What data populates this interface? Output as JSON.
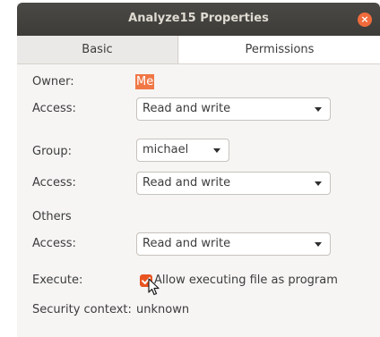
{
  "window": {
    "title": "Analyze15 Properties",
    "close_symbol": "×"
  },
  "tabs": [
    {
      "label": "Basic",
      "active": false
    },
    {
      "label": "Permissions",
      "active": true
    }
  ],
  "permissions": {
    "owner_label": "Owner:",
    "owner_value": "Me",
    "owner_access_label": "Access:",
    "owner_access_value": "Read and write",
    "group_label": "Group:",
    "group_value": "michael",
    "group_access_label": "Access:",
    "group_access_value": "Read and write",
    "others_label": "Others",
    "others_access_label": "Access:",
    "others_access_value": "Read and write",
    "execute_label": "Execute:",
    "execute_checkbox_label": "Allow executing file as program",
    "execute_checked": true,
    "security_label": "Security context:",
    "security_value": "unknown"
  },
  "colors": {
    "accent": "#e95420",
    "owner_highlight": "#f07746",
    "titlebar": "#3d3c38"
  }
}
